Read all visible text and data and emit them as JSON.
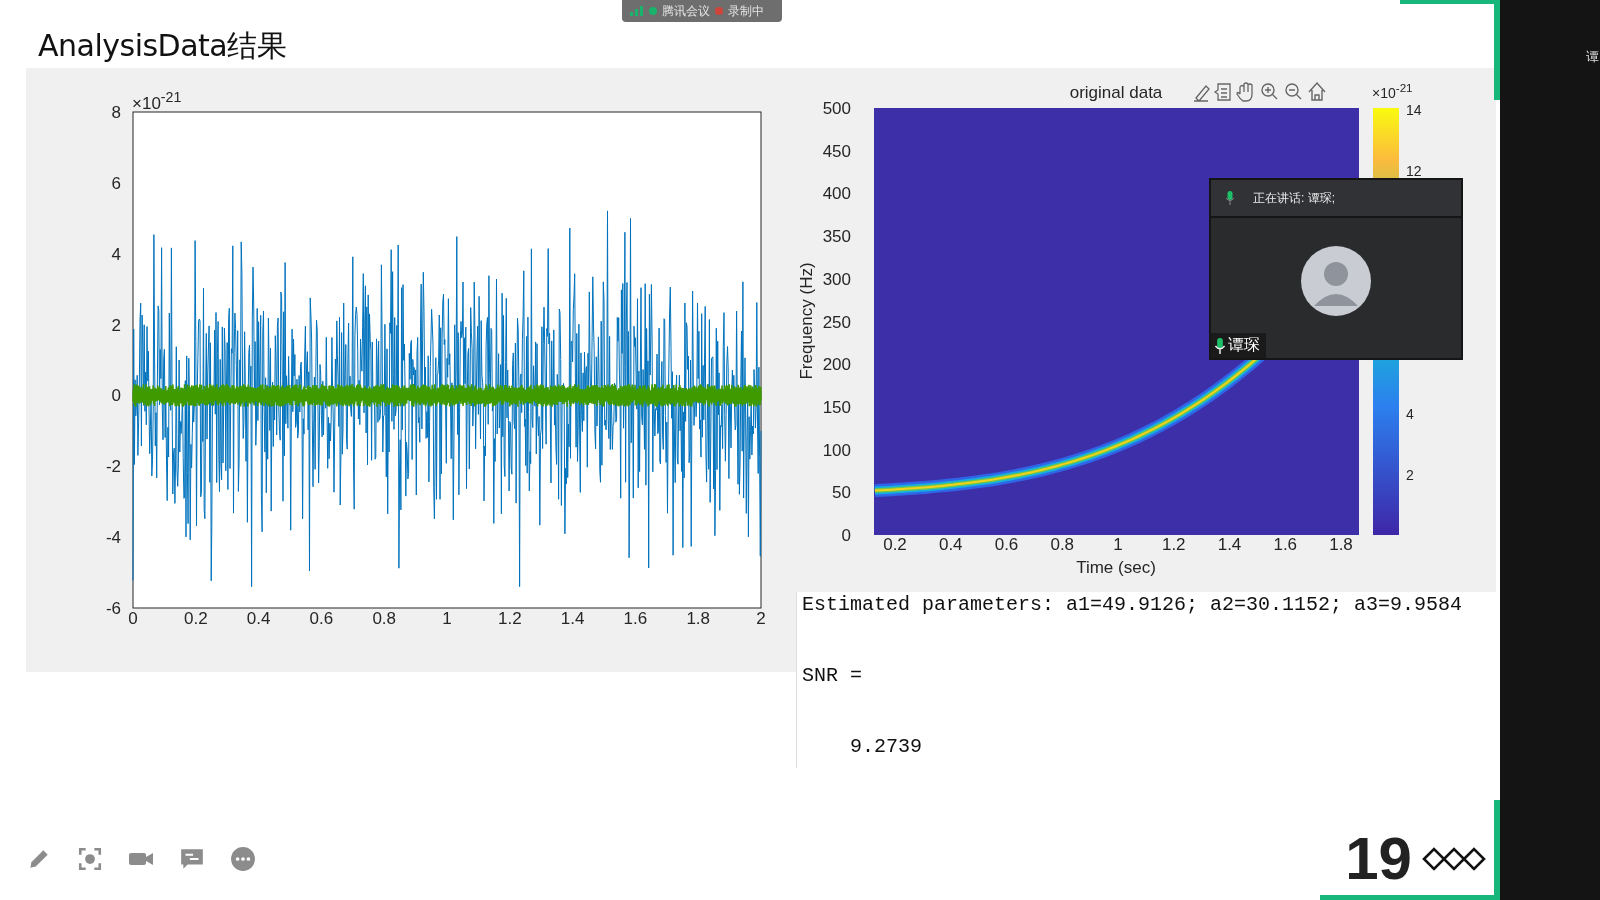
{
  "meeting_bar": {
    "app_name": "腾讯会议",
    "recording_label": "录制中"
  },
  "slide": {
    "title": "AnalysisData结果",
    "page_number": "19"
  },
  "left_plot": {
    "exponent": "×10$^{-21}$",
    "yticks": [
      "8",
      "6",
      "4",
      "2",
      "0",
      "-2",
      "-4",
      "-6"
    ],
    "xticks": [
      "0",
      "0.2",
      "0.4",
      "0.6",
      "0.8",
      "1",
      "1.2",
      "1.4",
      "1.6",
      "1.8",
      "2"
    ]
  },
  "right_plot": {
    "title": "original data",
    "ylabel": "Frequency (Hz)",
    "xlabel": "Time (sec)",
    "yticks": [
      "500",
      "450",
      "400",
      "350",
      "300",
      "250",
      "200",
      "150",
      "100",
      "50",
      "0"
    ],
    "xticks": [
      "0.2",
      "0.4",
      "0.6",
      "0.8",
      "1",
      "1.2",
      "1.4",
      "1.6",
      "1.8"
    ],
    "colorbar": {
      "exponent": "×10$^{-21}$",
      "ticks": [
        "14",
        "12",
        "4",
        "2"
      ]
    }
  },
  "console": {
    "lines": [
      "Estimated parameters: a1=49.9126; a2=30.1152; a3=9.9584",
      "SNR =",
      "    9.2739"
    ]
  },
  "speaker_window": {
    "status": "正在讲话: 谭琛;",
    "name": "谭琛"
  },
  "side_panel": {
    "text": "谭"
  }
}
